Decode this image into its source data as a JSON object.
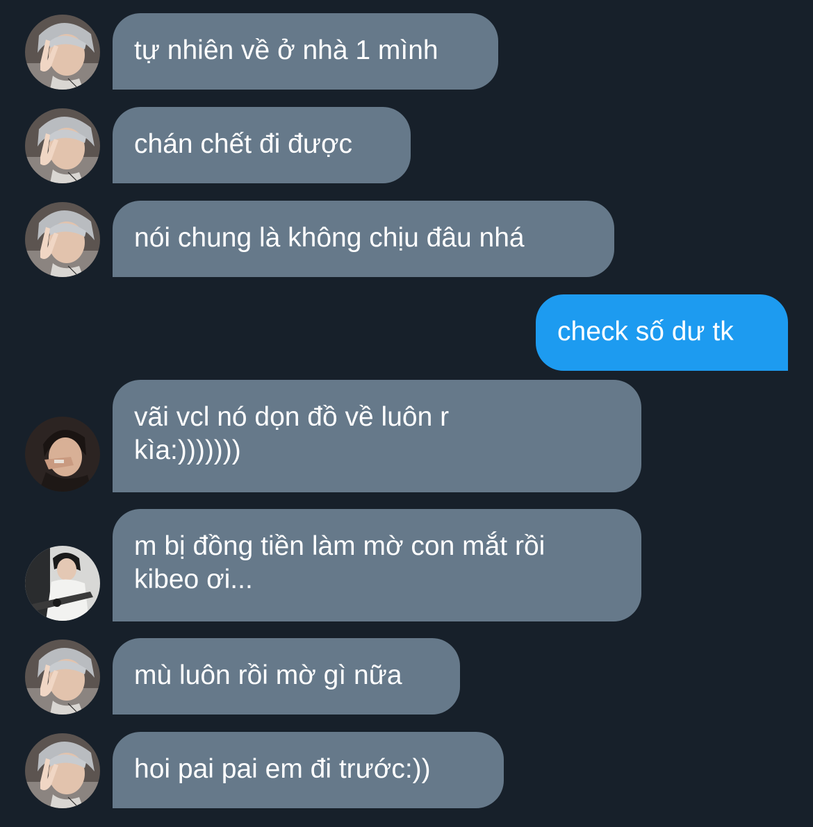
{
  "conversation": {
    "messages": [
      {
        "direction": "received",
        "avatar": "avatar-gray-hair-peace-sign",
        "lines": [
          "tự nhiên về ở nhà 1 mình"
        ]
      },
      {
        "direction": "received",
        "avatar": "avatar-gray-hair-peace-sign",
        "lines": [
          "chán chết đi được"
        ]
      },
      {
        "direction": "received",
        "avatar": "avatar-gray-hair-peace-sign",
        "lines": [
          "nói chung là không chịu đâu nhá"
        ]
      },
      {
        "direction": "sent",
        "lines": [
          "check số dư tk"
        ]
      },
      {
        "direction": "received",
        "avatar": "avatar-dark-hair-hand-on-face",
        "lines": [
          "vãi vcl nó dọn đồ về luôn r",
          "kìa:)))))))"
        ]
      },
      {
        "direction": "received",
        "avatar": "avatar-guitar-player",
        "lines": [
          "m bị đồng tiền làm mờ con mắt rồi",
          "kibeo ơi..."
        ]
      },
      {
        "direction": "received",
        "avatar": "avatar-gray-hair-peace-sign",
        "lines": [
          "mù luôn rồi mờ gì nữa"
        ]
      },
      {
        "direction": "received",
        "avatar": "avatar-gray-hair-peace-sign",
        "lines": [
          "hoi pai pai em đi trước:))"
        ]
      }
    ]
  },
  "colors": {
    "background": "#17202a",
    "received_bubble": "#66798a",
    "sent_bubble": "#1d9bf0",
    "text": "#ffffff"
  }
}
